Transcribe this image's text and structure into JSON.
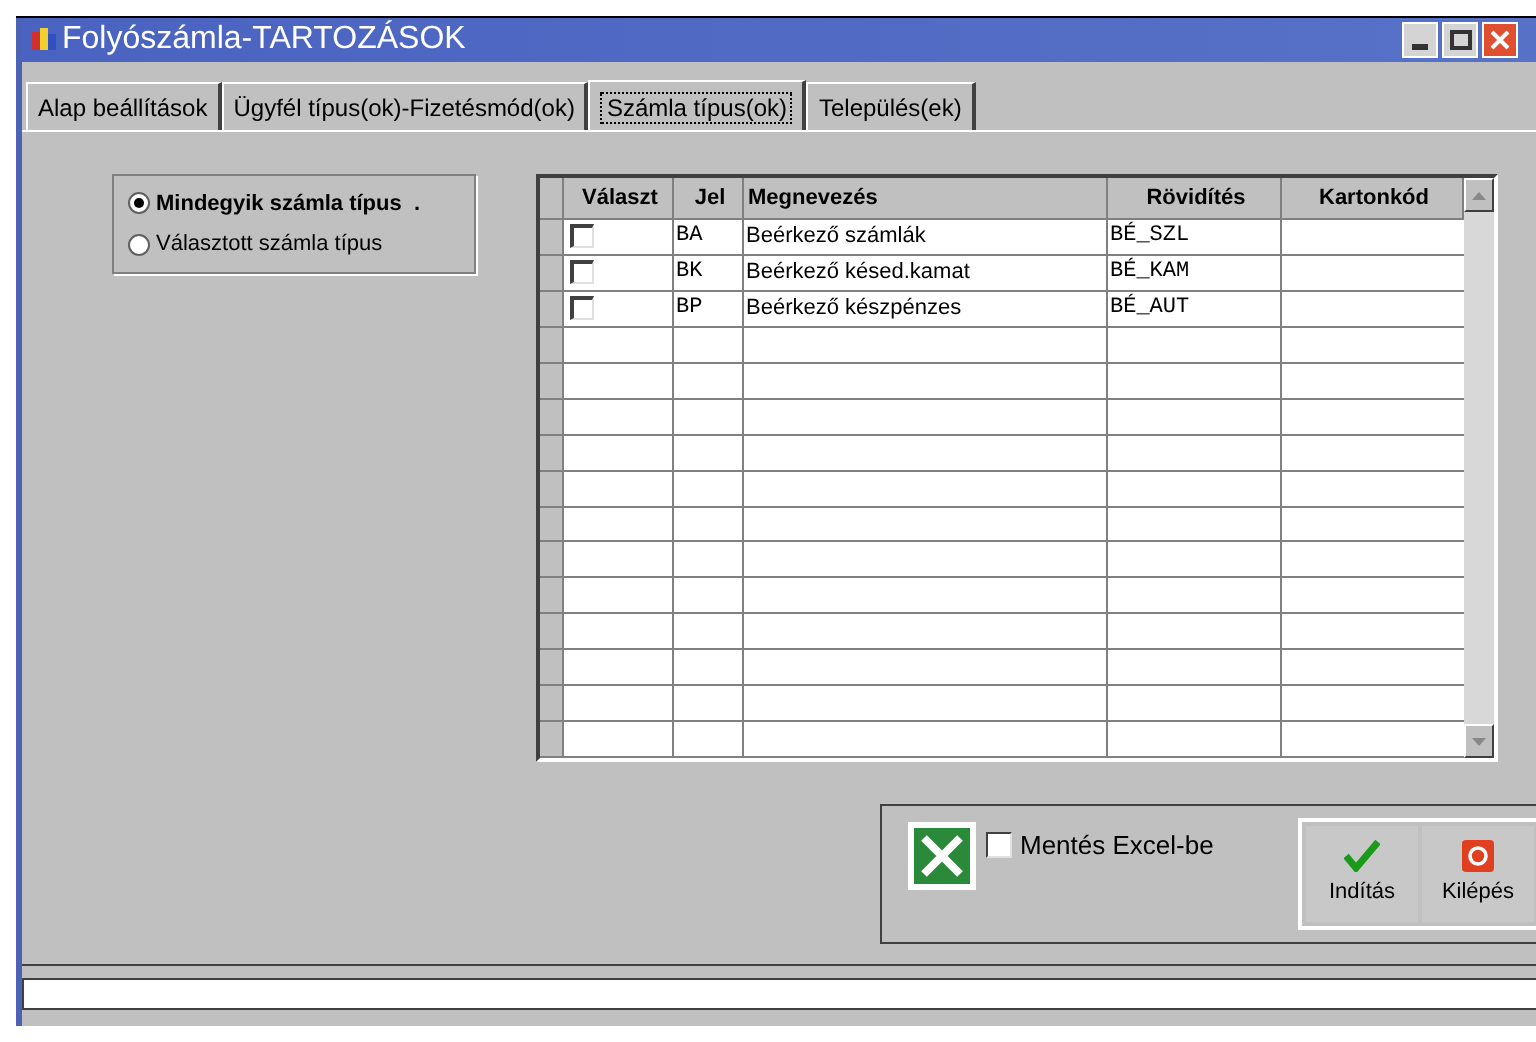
{
  "window": {
    "title": "Folyószámla-TARTOZÁSOK"
  },
  "tabs": [
    {
      "label": "Alap beállítások",
      "selected": false
    },
    {
      "label": "Ügyfél típus(ok)-Fizetésmód(ok)",
      "selected": false
    },
    {
      "label": "Számla típus(ok)",
      "selected": true
    },
    {
      "label": "Település(ek)",
      "selected": false
    }
  ],
  "filter": [
    {
      "label": "Mindegyik számla típus  .",
      "selected": true
    },
    {
      "label": "Választott számla típus",
      "selected": false
    }
  ],
  "table": {
    "columns": [
      "Választ",
      "Jel",
      "Megnevezés",
      "Rövidítés",
      "Kartonkód"
    ],
    "rows": [
      {
        "checked": false,
        "code": "BA",
        "name": "Beérkező számlák",
        "abbr": "BÉ_SZL"
      },
      {
        "checked": false,
        "code": "BK",
        "name": "Beérkező késed.kamat",
        "abbr": "BÉ_KAM"
      },
      {
        "checked": false,
        "code": "BP",
        "name": "Beérkező készpénzes",
        "abbr": "BÉ_AUT"
      }
    ]
  },
  "export": {
    "label": "Mentés Excel-be",
    "checked": false
  },
  "buttons": [
    {
      "kind": "start",
      "label": "Indítás"
    },
    {
      "kind": "exit",
      "label": "Kilépés"
    }
  ]
}
